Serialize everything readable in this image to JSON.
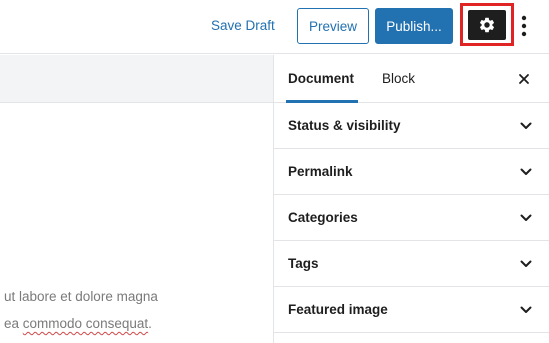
{
  "toolbar": {
    "save_draft_label": "Save Draft",
    "preview_label": "Preview",
    "publish_label": "Publish...",
    "settings_icon": "gear-icon",
    "more_icon": "vertical-ellipsis-icon",
    "highlight_color": "#e02424",
    "accent_color": "#2271b1"
  },
  "sidebar": {
    "tabs": [
      {
        "label": "Document"
      },
      {
        "label": "Block"
      }
    ],
    "close_icon": "close-icon",
    "panels": [
      {
        "title": "Status & visibility"
      },
      {
        "title": "Permalink"
      },
      {
        "title": "Categories"
      },
      {
        "title": "Tags"
      },
      {
        "title": "Featured image"
      }
    ]
  },
  "editor": {
    "line1": "ut labore et dolore magna",
    "line2_prefix": "ea ",
    "line2_misspelled": "commodo consequat",
    "line2_suffix": "."
  }
}
